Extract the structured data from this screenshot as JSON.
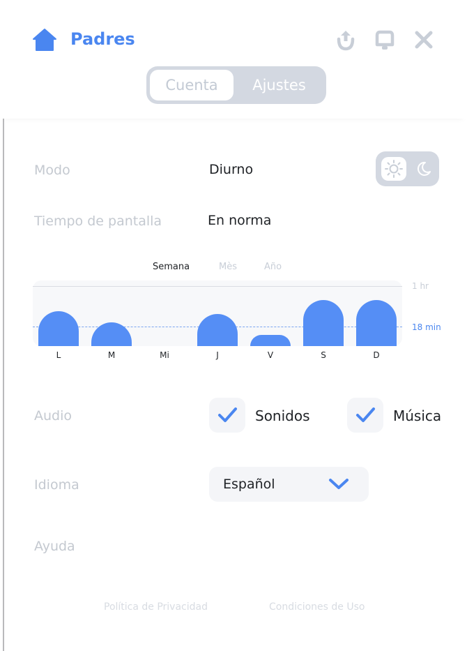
{
  "header": {
    "title": "Padres",
    "tabs": [
      "Cuenta",
      "Ajustes"
    ],
    "active_tab": "Ajustes",
    "icons": [
      "home-icon",
      "share-icon",
      "notification-icon",
      "close-icon"
    ],
    "accent_color": "#4a86f0"
  },
  "settings": {
    "mode_label": "Modo",
    "mode_value": "Diurno",
    "mode_icons": [
      "sun-icon",
      "moon-icon"
    ],
    "screen_time_label": "Tiempo de pantalla",
    "screen_time_value": "En norma",
    "audio_label": "Audio",
    "audio_options": [
      {
        "label": "Sonidos",
        "checked": true
      },
      {
        "label": "Música",
        "checked": true
      }
    ],
    "language_label": "Idioma",
    "language_value": "Español",
    "help_label": "Ayuda"
  },
  "chart_tabs": [
    "Semana",
    "Mès",
    "Año"
  ],
  "chart_active_tab": "Semana",
  "chart_data": {
    "type": "bar",
    "categories": [
      "L",
      "M",
      "Mi",
      "J",
      "V",
      "S",
      "D"
    ],
    "values": [
      35,
      24,
      0,
      32,
      11,
      46,
      46
    ],
    "ylim": [
      0,
      60
    ],
    "y_tick_labels": [
      "1 hr",
      "18 min"
    ],
    "reference_line": 18,
    "bar_color": "#558ef5"
  },
  "footer": {
    "privacy": "Política de Privacidad",
    "terms": "Condiciones de Uso"
  }
}
